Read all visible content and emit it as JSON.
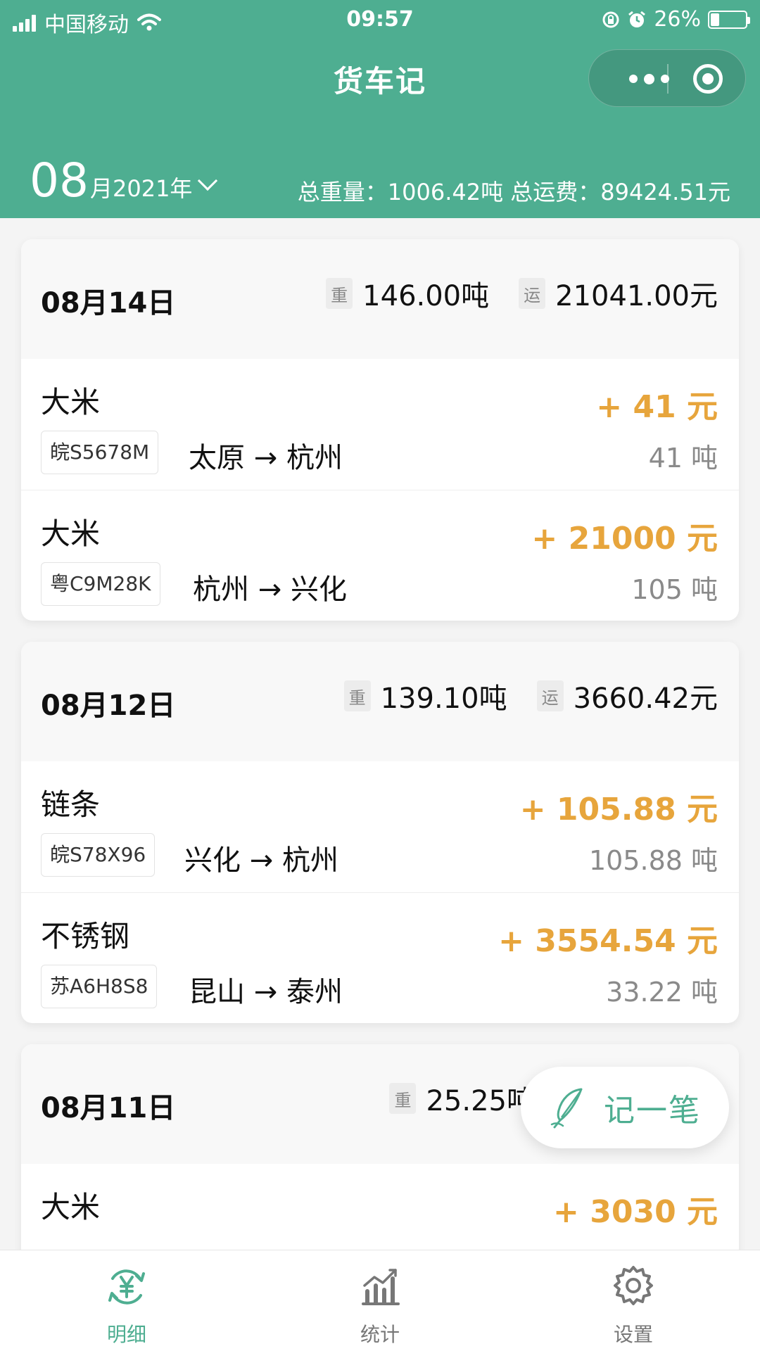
{
  "status_bar": {
    "carrier": "中国移动",
    "time": "09:57",
    "battery": "26%",
    "battery_level": 0.26
  },
  "app": {
    "title": "货车记"
  },
  "summary": {
    "month": "08",
    "month_rest": "月2021年",
    "totals": "总重量：1006.42吨 总运费：89424.51元"
  },
  "labels": {
    "weight_chip": "重",
    "fee_chip": "运"
  },
  "days": [
    {
      "date": "08月14日",
      "weight": "146.00吨",
      "fee": "21041.00元",
      "entries": [
        {
          "cargo": "大米",
          "plate": "皖S5678M",
          "route": "太原 → 杭州",
          "amount": "+ 41 元",
          "weight": "41 吨"
        },
        {
          "cargo": "大米",
          "plate": "粤C9M28K",
          "route": "杭州 → 兴化",
          "amount": "+ 21000 元",
          "weight": "105 吨"
        }
      ]
    },
    {
      "date": "08月12日",
      "weight": "139.10吨",
      "fee": "3660.42元",
      "entries": [
        {
          "cargo": "链条",
          "plate": "皖S78X96",
          "route": "兴化 → 杭州",
          "amount": "+ 105.88 元",
          "weight": "105.88 吨"
        },
        {
          "cargo": "不锈钢",
          "plate": "苏A6H8S8",
          "route": "昆山 → 泰州",
          "amount": "+ 3554.54 元",
          "weight": "33.22 吨"
        }
      ]
    },
    {
      "date": "08月11日",
      "weight": "25.25吨",
      "entries": [
        {
          "cargo": "大米",
          "amount": "+ 3030 元"
        }
      ]
    }
  ],
  "fab": {
    "label": "记一笔"
  },
  "tabs": [
    {
      "label": "明细",
      "icon": "yuan-refresh-icon",
      "active": true
    },
    {
      "label": "统计",
      "icon": "bar-chart-icon"
    },
    {
      "label": "设置",
      "icon": "gear-icon"
    }
  ],
  "colors": {
    "primary": "#4eae91",
    "amount": "#e7a53c"
  }
}
